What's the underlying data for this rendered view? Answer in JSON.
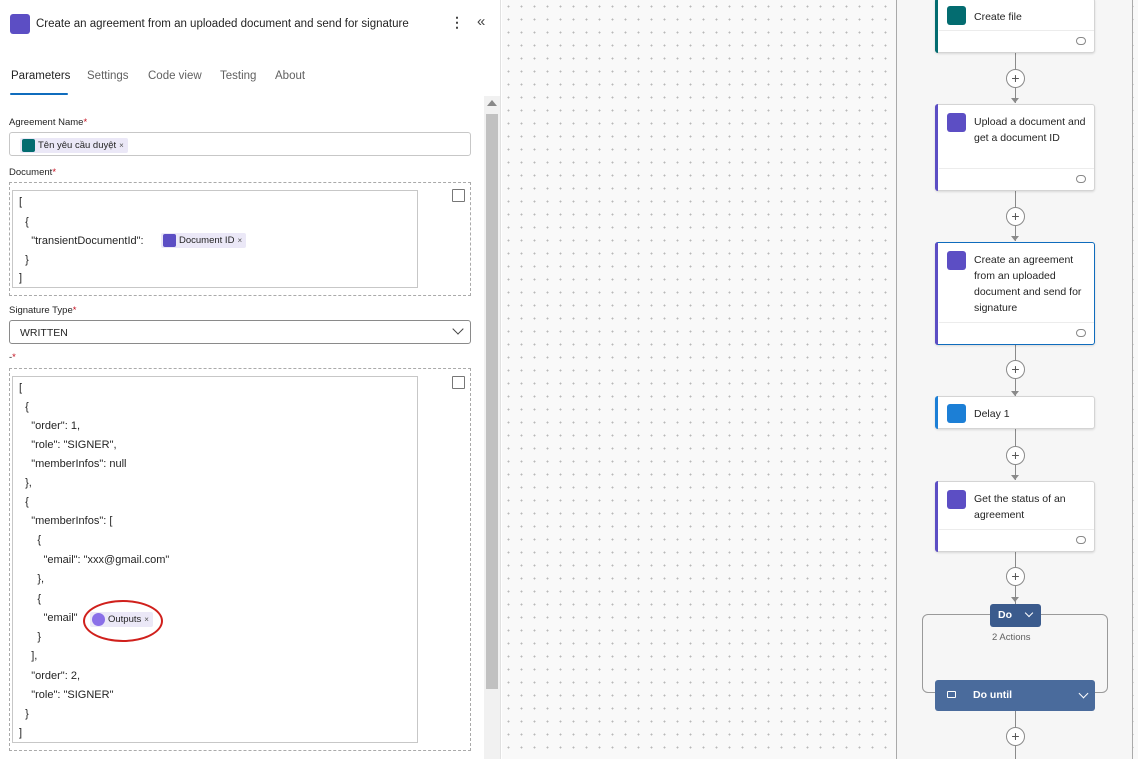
{
  "panel": {
    "title": "Create an agreement from an uploaded document and send for signature",
    "more_glyph": "⋮",
    "collapse_glyph": "«",
    "tabs": [
      {
        "label": "Parameters",
        "active": true
      },
      {
        "label": "Settings",
        "active": false
      },
      {
        "label": "Code view",
        "active": false
      },
      {
        "label": "Testing",
        "active": false
      },
      {
        "label": "About",
        "active": false
      }
    ],
    "fields": {
      "agreement_name": {
        "label": "Agreement Name",
        "required": "*",
        "token": "Tên yêu cầu duyệt",
        "token_close": "×"
      },
      "document": {
        "label": "Document",
        "required": "*",
        "lines": [
          "[",
          "  {",
          "    \"transientDocumentId\":",
          "  }",
          "]"
        ],
        "token": "Document ID",
        "token_close": "×"
      },
      "signature_type": {
        "label": "Signature Type",
        "required": "*",
        "value": "WRITTEN"
      },
      "participants": {
        "label": "-",
        "required": "*",
        "lines": [
          "[",
          "  {",
          "    \"order\": 1,",
          "    \"role\": \"SIGNER\",",
          "    \"memberInfos\": null",
          "  },",
          "  {",
          "    \"memberInfos\": [",
          "      {",
          "        \"email\": \"xxx@gmail.com\"",
          "      },",
          "      {",
          "        \"email\"",
          "      }",
          "    ],",
          "    \"order\": 2,",
          "    \"role\": \"SIGNER\"",
          "  }",
          "]"
        ],
        "token": "Outputs",
        "token_close": "×"
      }
    }
  },
  "flow": {
    "cards": [
      {
        "title": "Create file",
        "icon": "sharepoint-icon",
        "accent": "#036c70"
      },
      {
        "title": "Upload a document and get a document ID",
        "icon": "adobe-sign-icon",
        "accent": "#5c4ec4"
      },
      {
        "title": "Create an agreement from an uploaded document and send for signature",
        "icon": "adobe-sign-icon",
        "accent": "#5c4ec4",
        "selected": true
      },
      {
        "title": "Delay 1",
        "icon": "timer-icon",
        "accent": "#1c7fd6"
      },
      {
        "title": "Get the status of an agreement",
        "icon": "adobe-sign-icon",
        "accent": "#5c4ec4"
      }
    ],
    "loop": {
      "label": "Do",
      "actions_count": "2 Actions",
      "until_label": "Do until"
    },
    "plus_glyph": "+"
  },
  "colors": {
    "accent_blue": "#0f6cbd",
    "adobe_purple": "#5c4ec4",
    "sharepoint_teal": "#036c70",
    "required_red": "#c50f1f",
    "annotation_red": "#d0201c"
  }
}
